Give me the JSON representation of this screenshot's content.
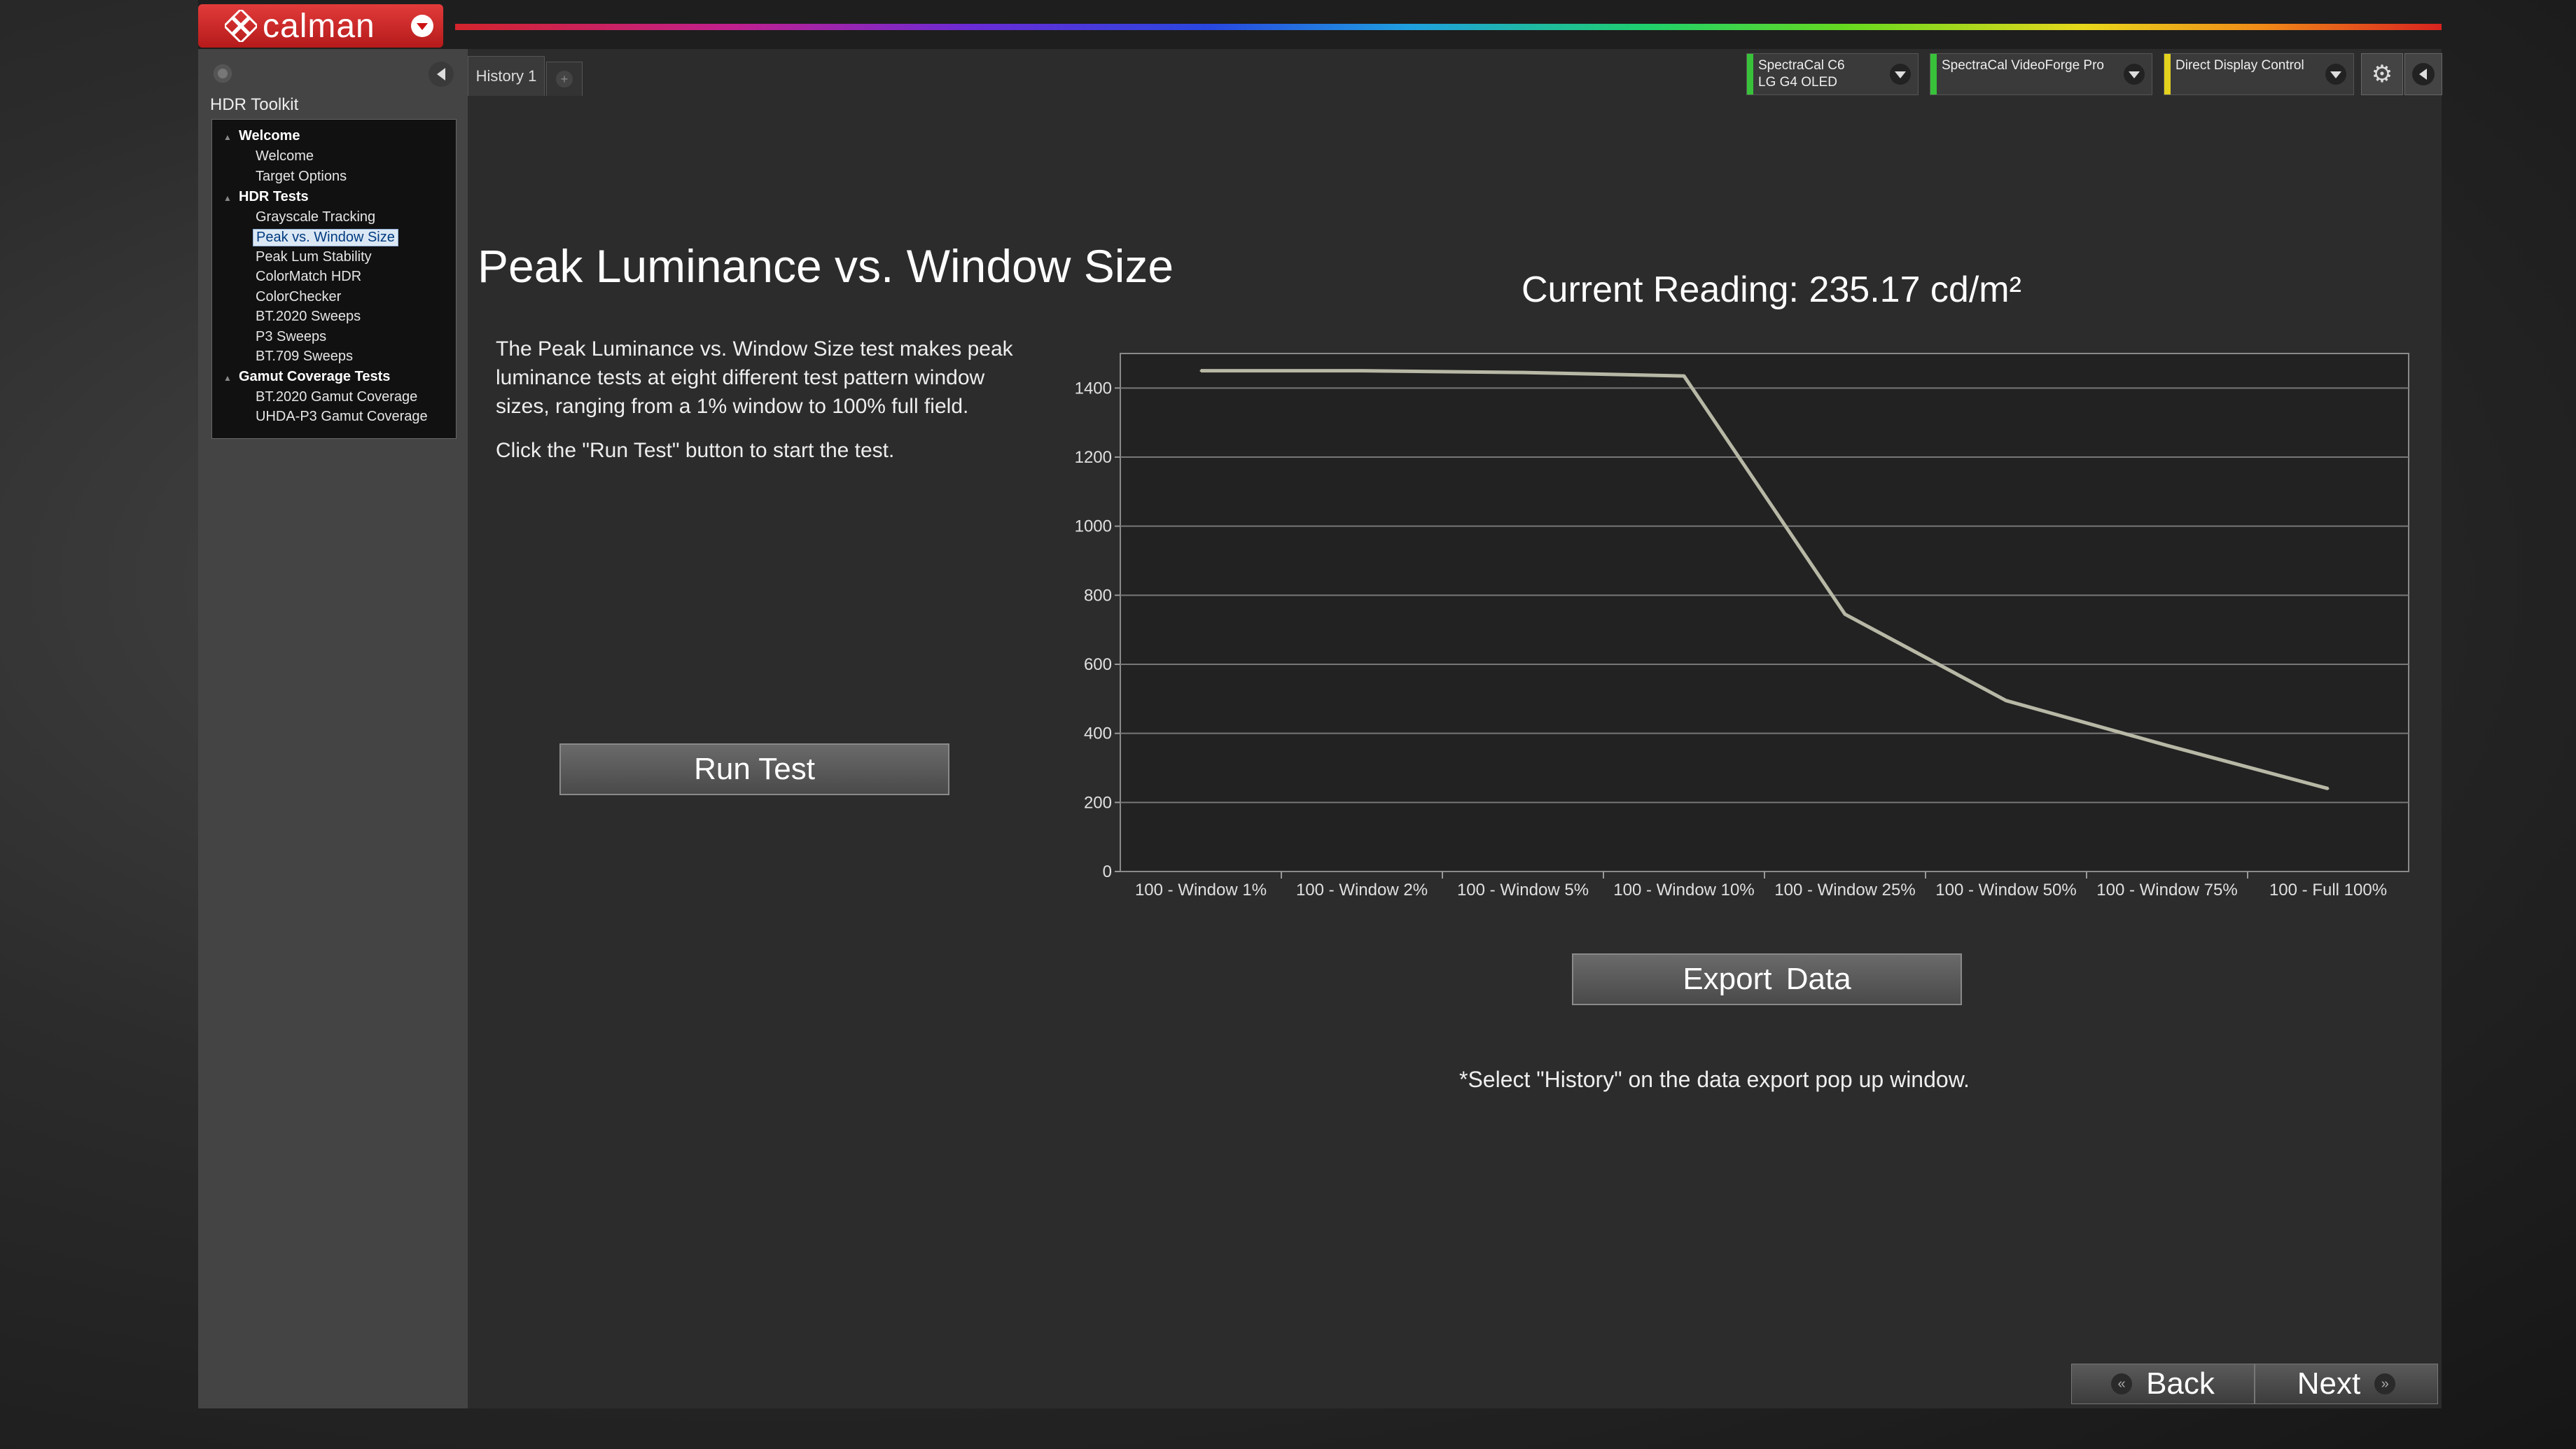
{
  "app": {
    "logo_text": "calman"
  },
  "sidebar": {
    "title": "HDR Toolkit",
    "tree": [
      {
        "label": "Welcome",
        "head": true
      },
      {
        "label": "Welcome"
      },
      {
        "label": "Target Options"
      },
      {
        "label": "HDR Tests",
        "head": true
      },
      {
        "label": "Grayscale Tracking"
      },
      {
        "label": "Peak vs. Window Size",
        "selected": true
      },
      {
        "label": "Peak Lum Stability"
      },
      {
        "label": "ColorMatch HDR"
      },
      {
        "label": "ColorChecker"
      },
      {
        "label": "BT.2020 Sweeps"
      },
      {
        "label": "P3 Sweeps"
      },
      {
        "label": "BT.709 Sweeps"
      },
      {
        "label": "Gamut Coverage Tests",
        "head": true
      },
      {
        "label": "BT.2020 Gamut Coverage"
      },
      {
        "label": "UHDA-P3 Gamut Coverage"
      }
    ]
  },
  "tabs": {
    "history": "History 1",
    "add": "+"
  },
  "devices": [
    {
      "line1": "SpectraCal C6",
      "line2": "LG G4 OLED",
      "color": "#38c23a"
    },
    {
      "line1": "SpectraCal VideoForge Pro",
      "line2": "",
      "color": "#38c23a"
    },
    {
      "line1": "Direct Display Control",
      "line2": "",
      "color": "#e4d21e"
    }
  ],
  "main": {
    "title": "Peak Luminance vs. Window Size",
    "description": "The Peak Luminance vs. Window Size test makes peak luminance tests at eight different test pattern window sizes, ranging from a 1% window to 100% full field.",
    "hint": "Click the \"Run Test\" button to start the test.",
    "run_test_label": "Run Test",
    "reading_label": "Current Reading: 235.17 cd/m²",
    "export_label": "Export Data",
    "note": "*Select \"History\" on the data export pop up window."
  },
  "nav": {
    "back_label": "Back",
    "next_label": "Next"
  },
  "chart_data": {
    "type": "line",
    "categories": [
      "100 - Window 1%",
      "100 - Window 2%",
      "100 - Window 5%",
      "100 - Window 10%",
      "100 - Window 25%",
      "100 - Window 50%",
      "100 - Window 75%",
      "100 - Full 100%"
    ],
    "series": [
      {
        "values": [
          1450,
          1450,
          1445,
          1435,
          745,
          495,
          365,
          240
        ]
      }
    ],
    "ylim": [
      0,
      1500
    ],
    "yticks": [
      0,
      200,
      400,
      600,
      800,
      1000,
      1200,
      1400
    ],
    "grid": true,
    "line_color": "#b8b8a6"
  }
}
